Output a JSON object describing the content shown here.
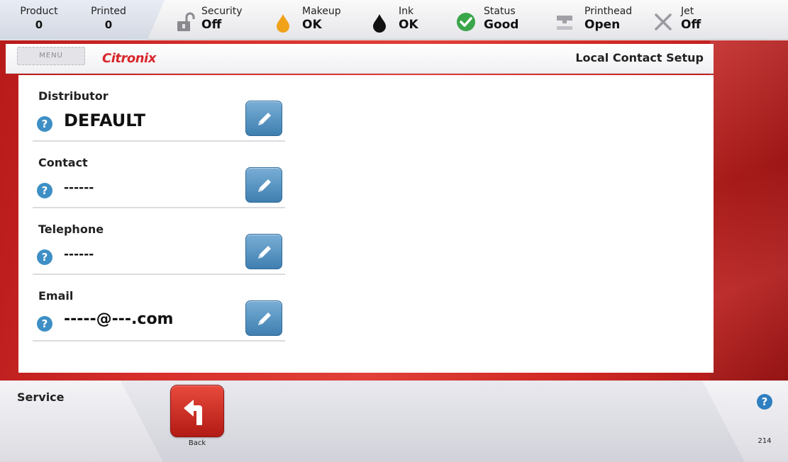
{
  "statusbar": {
    "product": {
      "label": "Product",
      "value": "0"
    },
    "printed": {
      "label": "Printed",
      "value": "0"
    },
    "security": {
      "label": "Security",
      "value": "Off",
      "icon": "padlock-open-icon"
    },
    "makeup": {
      "label": "Makeup",
      "value": "OK",
      "icon": "makeup-drop-icon",
      "color": "#f0a21a"
    },
    "ink": {
      "label": "Ink",
      "value": "OK",
      "icon": "ink-drop-icon",
      "color": "#111111"
    },
    "status": {
      "label": "Status",
      "value": "Good",
      "icon": "check-circle-icon",
      "color": "#3aa64a"
    },
    "printhead": {
      "label": "Printhead",
      "value": "Open",
      "icon": "printhead-icon"
    },
    "jet": {
      "label": "Jet",
      "value": "Off",
      "icon": "jet-off-x-icon"
    }
  },
  "header": {
    "menu_label": "MENU",
    "logo_text": "Citronix",
    "title": "Local Contact Setup"
  },
  "fields": [
    {
      "label": "Distributor",
      "value": "DEFAULT"
    },
    {
      "label": "Contact",
      "value": "------"
    },
    {
      "label": "Telephone",
      "value": "------"
    },
    {
      "label": "Email",
      "value": "-----@---.com"
    }
  ],
  "help_symbol": "?",
  "footer": {
    "section": "Service",
    "back_label": "Back",
    "screen_number": "214"
  },
  "colors": {
    "brand_red": "#d8262b",
    "edit_blue": "#4a8bbd",
    "help_blue": "#3d8fc5"
  }
}
